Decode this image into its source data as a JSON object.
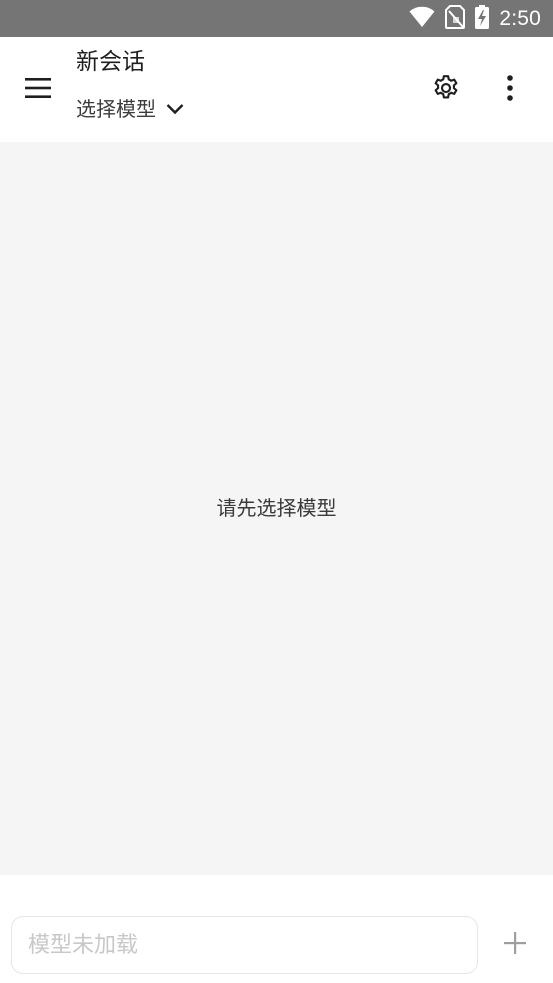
{
  "status_bar": {
    "time": "2:50",
    "icons": [
      "wifi-icon",
      "no-sim-icon",
      "battery-charging-icon"
    ]
  },
  "app_bar": {
    "title": "新会话",
    "model_selector_label": "选择模型",
    "icons": [
      "menu-icon",
      "chevron-down-icon",
      "settings-gear-icon",
      "more-vert-icon"
    ]
  },
  "chat": {
    "empty_hint": "请先选择模型"
  },
  "input": {
    "placeholder": "模型未加载",
    "value": "",
    "add_icon": "plus-icon"
  },
  "colors": {
    "status_bar_bg": "#757575",
    "app_bar_bg": "#ffffff",
    "chat_bg": "#f5f5f5",
    "placeholder_text": "#c8c8c8"
  }
}
